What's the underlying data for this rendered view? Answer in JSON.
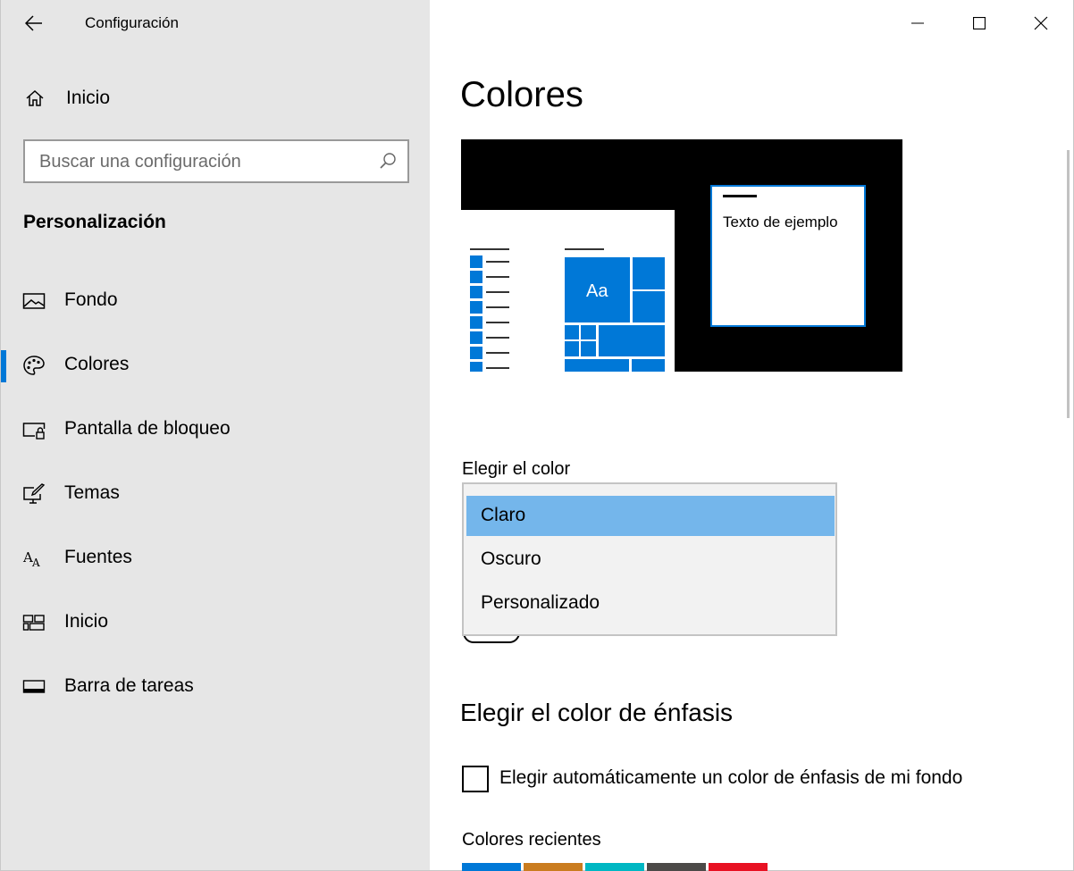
{
  "app": {
    "title": "Configuración"
  },
  "sidebar": {
    "home_label": "Inicio",
    "search_placeholder": "Buscar una configuración",
    "section_title": "Personalización",
    "items": [
      {
        "label": "Fondo",
        "icon": "picture-icon"
      },
      {
        "label": "Colores",
        "icon": "palette-icon",
        "selected": true
      },
      {
        "label": "Pantalla de bloqueo",
        "icon": "lock-screen-icon"
      },
      {
        "label": "Temas",
        "icon": "brush-icon"
      },
      {
        "label": "Fuentes",
        "icon": "font-icon"
      },
      {
        "label": "Inicio",
        "icon": "start-icon"
      },
      {
        "label": "Barra de tareas",
        "icon": "taskbar-icon"
      }
    ]
  },
  "main": {
    "title": "Colores",
    "preview": {
      "sample_text": "Texto de ejemplo",
      "tile_text": "Aa"
    },
    "choose_color": {
      "label": "Elegir el color",
      "options": [
        "Claro",
        "Oscuro",
        "Personalizado"
      ],
      "selected": "Claro"
    },
    "accent": {
      "title": "Elegir el color de énfasis",
      "auto_checkbox_label": "Elegir automáticamente un color de énfasis de mi fondo",
      "auto_checked": false,
      "recent_label": "Colores recientes",
      "recent_colors": [
        "#0078d7",
        "#ca7c1f",
        "#00b7c3",
        "#4c4a48",
        "#e81123"
      ]
    }
  },
  "colors": {
    "accent": "#0078d7",
    "sidebar_bg": "#e6e6e6",
    "dropdown_selected": "#74b6eb"
  }
}
